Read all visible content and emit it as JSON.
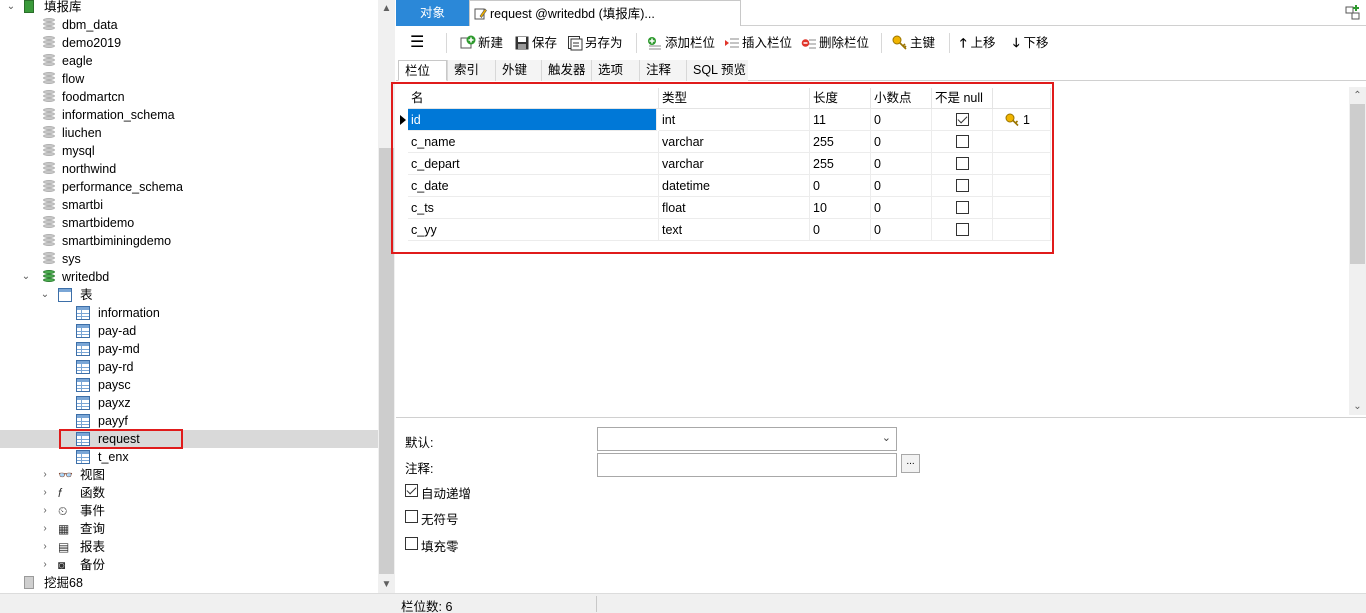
{
  "tree": {
    "root_label": "填报库",
    "databases": [
      "dbm_data",
      "demo2019",
      "eagle",
      "flow",
      "foodmartcn",
      "information_schema",
      "liuchen",
      "mysql",
      "northwind",
      "performance_schema",
      "smartbi",
      "smartbidemo",
      "smartbiminingdemo",
      "sys"
    ],
    "open_db": "writedbd",
    "tables_group": "表",
    "tables": [
      "information",
      "pay-ad",
      "pay-md",
      "pay-rd",
      "paysc",
      "payxz",
      "payyf",
      "request",
      "t_enx"
    ],
    "selected_table": "request",
    "groups": [
      "视图",
      "函数",
      "事件",
      "查询",
      "报表",
      "备份"
    ],
    "other_connection": "挖掘68"
  },
  "tabs": {
    "objects": "对象",
    "editor": "request @writedbd (填报库)..."
  },
  "toolbar": {
    "new": "新建",
    "save": "保存",
    "save_as": "另存为",
    "add_field": "添加栏位",
    "insert_field": "插入栏位",
    "delete_field": "删除栏位",
    "primary_key": "主键",
    "move_up": "上移",
    "move_down": "下移"
  },
  "subtabs": [
    "栏位",
    "索引",
    "外键",
    "触发器",
    "选项",
    "注释",
    "SQL 预览"
  ],
  "grid": {
    "headers": [
      "名",
      "类型",
      "长度",
      "小数点",
      "不是 null",
      ""
    ],
    "rows": [
      {
        "name": "id",
        "type": "int",
        "length": "11",
        "decimals": "0",
        "not_null": true,
        "key": "1"
      },
      {
        "name": "c_name",
        "type": "varchar",
        "length": "255",
        "decimals": "0",
        "not_null": false,
        "key": ""
      },
      {
        "name": "c_depart",
        "type": "varchar",
        "length": "255",
        "decimals": "0",
        "not_null": false,
        "key": ""
      },
      {
        "name": "c_date",
        "type": "datetime",
        "length": "0",
        "decimals": "0",
        "not_null": false,
        "key": ""
      },
      {
        "name": "c_ts",
        "type": "float",
        "length": "10",
        "decimals": "0",
        "not_null": false,
        "key": ""
      },
      {
        "name": "c_yy",
        "type": "text",
        "length": "0",
        "decimals": "0",
        "not_null": false,
        "key": ""
      }
    ]
  },
  "props": {
    "default_label": "默认:",
    "comment_label": "注释:",
    "dots": "...",
    "auto_increment": "自动递增",
    "unsigned": "无符号",
    "zerofill": "填充零"
  },
  "status": {
    "field_count": "栏位数: 6"
  },
  "colors": {
    "accent": "#2b88d8",
    "selection": "#0078d7",
    "highlight_border": "#e01b1b"
  }
}
